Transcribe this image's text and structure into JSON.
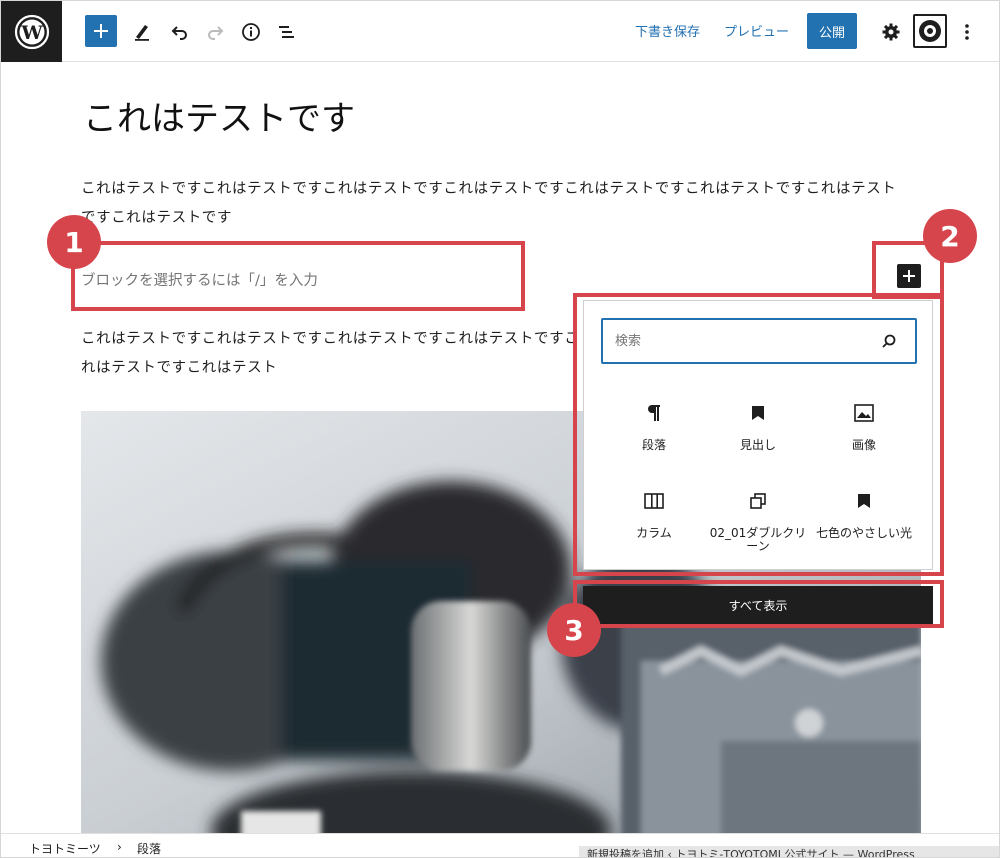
{
  "toolbar": {
    "save_draft": "下書き保存",
    "preview": "プレビュー",
    "publish": "公開"
  },
  "post": {
    "title": "これはテストです",
    "paragraph1": "これはテストですこれはテストですこれはテストですこれはテストですこれはテストですこれはテストですこれはテストですこれはテストです",
    "placeholder": "ブロックを選択するには「/」を入力",
    "paragraph2": "これはテストですこれはテストですこれはテストですこれはテストですこれはテストですこれはテスト"
  },
  "annotations": [
    "1",
    "2",
    "3"
  ],
  "inserter": {
    "search_placeholder": "検索",
    "blocks": [
      {
        "label": "段落",
        "icon": "paragraph-icon"
      },
      {
        "label": "見出し",
        "icon": "bookmark-icon"
      },
      {
        "label": "画像",
        "icon": "image-icon"
      },
      {
        "label": "カラム",
        "icon": "columns-icon"
      },
      {
        "label": "02_01ダブルクリーン",
        "icon": "reusable-block-icon"
      },
      {
        "label": "七色のやさしい光",
        "icon": "bookmark-icon"
      }
    ],
    "show_all": "すべて表示"
  },
  "breadcrumb": {
    "root": "トヨトミーツ",
    "current": "段落"
  },
  "window_title": "新規投稿を追加 ‹ トヨトミ-TOYOTOMI 公式サイト — WordPress",
  "colors": {
    "accent": "#2271b1",
    "annotation": "#d6454b",
    "dark": "#1e1e1e"
  }
}
